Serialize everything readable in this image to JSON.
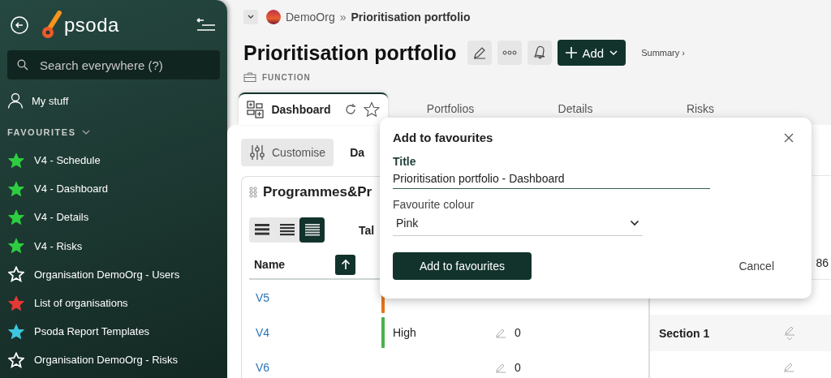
{
  "sidebar": {
    "logo": "psoda",
    "search": {
      "placeholder": "Search everywhere (?)"
    },
    "my_stuff": "My stuff",
    "section": {
      "label": "FAVOURITES",
      "expanded": true
    },
    "favourites": [
      {
        "label": "V4 - Schedule",
        "filled": true,
        "color": "#2ecc40"
      },
      {
        "label": "V4 - Dashboard",
        "filled": true,
        "color": "#2ecc40"
      },
      {
        "label": "V4 - Details",
        "filled": true,
        "color": "#2ecc40"
      },
      {
        "label": "V4 - Risks",
        "filled": true,
        "color": "#2ecc40"
      },
      {
        "label": "Organisation DemoOrg - Users",
        "filled": false,
        "color": "#ffffff"
      },
      {
        "label": "List of organisations",
        "filled": true,
        "color": "#e53935"
      },
      {
        "label": "Psoda Report Templates",
        "filled": true,
        "color": "#3ec6e0"
      },
      {
        "label": "Organisation DemoOrg - Risks",
        "filled": false,
        "color": "#ffffff"
      }
    ]
  },
  "breadcrumb": {
    "org": "DemoOrg",
    "separator": "»",
    "current": "Prioritisation portfolio"
  },
  "header": {
    "title": "Prioritisation portfolio",
    "add_label": "Add",
    "summary": "Summary ›",
    "type": "FUNCTION"
  },
  "tabs": [
    {
      "label": "Dashboard",
      "selected": true
    },
    {
      "label": "Portfolios",
      "selected": false
    },
    {
      "label": "Details",
      "selected": false
    },
    {
      "label": "Risks",
      "selected": false
    }
  ],
  "dashboard": {
    "customise": "Customise",
    "tab_partial": "Da",
    "card": {
      "title": "Programmes&Pr",
      "views": [
        {
          "selected": false
        },
        {
          "selected": false
        },
        {
          "selected": true
        }
      ],
      "view_label": "Tal",
      "columns": [
        "Name"
      ],
      "rows": [
        {
          "name": "V5",
          "color": "#e8751a"
        },
        {
          "name": "V4",
          "color": "#4caf50",
          "priority": "High",
          "value": "0"
        },
        {
          "name": "V6",
          "value": "0"
        }
      ]
    }
  },
  "side_panel": {
    "partial": "86",
    "section": "Section 1"
  },
  "dialog": {
    "title": "Add to favourites",
    "title_label": "Title",
    "title_value": "Prioritisation portfolio - Dashboard",
    "colour_label": "Favourite colour",
    "colour_value": "Pink",
    "submit": "Add to favourites",
    "cancel": "Cancel"
  }
}
